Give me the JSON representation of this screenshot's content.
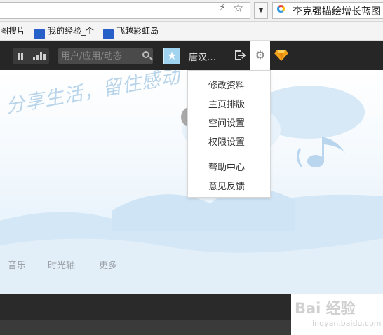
{
  "browser": {
    "search_query": "李克强描绘增长蓝图",
    "bookmarks": [
      "图搜片",
      "我的经验_个",
      "飞越彩虹岛"
    ]
  },
  "topbar": {
    "search_placeholder": "用户/应用/动态",
    "username": "唐汉…",
    "accent": "#262626"
  },
  "banner": {
    "slogan": "分享生活，留住感动",
    "nav": [
      "音乐",
      "时光轴",
      "更多"
    ]
  },
  "menu": {
    "group1": [
      "修改资料",
      "主页排版",
      "空间设置",
      "权限设置"
    ],
    "group2": [
      "帮助中心",
      "意见反馈"
    ]
  },
  "watermark": {
    "brand": "Bai 经验",
    "url": "jingyan.baidu.com"
  }
}
